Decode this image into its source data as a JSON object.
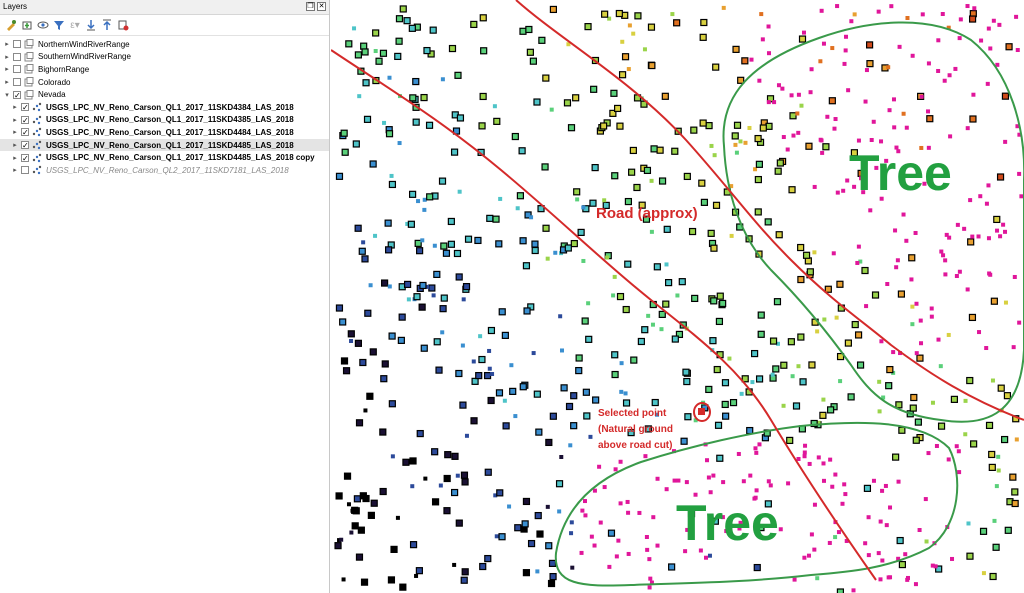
{
  "layers_panel": {
    "title": "Layers",
    "title_buttons": [
      "restore-icon",
      "close-icon"
    ],
    "toolbar_icons": [
      "open-layer-styling-icon",
      "add-group-icon",
      "manage-map-themes-icon",
      "filter-legend-icon",
      "filter-by-expression-icon",
      "expand-all-icon",
      "collapse-all-icon",
      "remove-layer-icon"
    ],
    "items": [
      {
        "label": "NorthernWindRiverRange",
        "checked": false,
        "indent": 0,
        "kind": "group",
        "expanded": false,
        "style": "normal"
      },
      {
        "label": "SouthernWindRiverRange",
        "checked": false,
        "indent": 0,
        "kind": "group",
        "expanded": false,
        "style": "normal"
      },
      {
        "label": "BighornRange",
        "checked": false,
        "indent": 0,
        "kind": "group",
        "expanded": false,
        "style": "normal"
      },
      {
        "label": "Colorado",
        "checked": false,
        "indent": 0,
        "kind": "group",
        "expanded": false,
        "style": "normal"
      },
      {
        "label": "Nevada",
        "checked": true,
        "indent": 0,
        "kind": "group",
        "expanded": true,
        "style": "normal"
      },
      {
        "label": "USGS_LPC_NV_Reno_Carson_QL1_2017_11SKD4384_LAS_2018",
        "checked": true,
        "indent": 1,
        "kind": "pointcloud",
        "style": "bold"
      },
      {
        "label": "USGS_LPC_NV_Reno_Carson_QL1_2017_11SKD4385_LAS_2018",
        "checked": true,
        "indent": 1,
        "kind": "pointcloud",
        "style": "bold"
      },
      {
        "label": "USGS_LPC_NV_Reno_Carson_QL1_2017_11SKD4484_LAS_2018",
        "checked": true,
        "indent": 1,
        "kind": "pointcloud",
        "style": "bold"
      },
      {
        "label": "USGS_LPC_NV_Reno_Carson_QL1_2017_11SKD4485_LAS_2018",
        "checked": true,
        "indent": 1,
        "kind": "pointcloud",
        "style": "bold",
        "selected": true
      },
      {
        "label": "USGS_LPC_NV_Reno_Carson_QL1_2017_11SKD4485_LAS_2018 copy",
        "checked": true,
        "indent": 1,
        "kind": "pointcloud",
        "style": "bold"
      },
      {
        "label": "USGS_LPC_NV_Reno_Carson_QL2_2017_11SKD7181_LAS_2018",
        "checked": false,
        "indent": 1,
        "kind": "pointcloud",
        "style": "italic-gray"
      }
    ]
  },
  "map": {
    "annotations": {
      "road": "Road (approx)",
      "tree_upper": "Tree",
      "tree_lower": "Tree",
      "selected_line1": "Selected point",
      "selected_line2": "(Natural ground",
      "selected_line3": "above road cut)"
    },
    "colors": {
      "road": "#d42a2a",
      "tree_outline": "#3a9a4a",
      "tree_text": "#22a040",
      "annotation_text": "#d42a2a",
      "vegetation_points": "#e0169a"
    },
    "point_palette": [
      "#000000",
      "#1a1033",
      "#2c4a9a",
      "#3a8fd0",
      "#4ec4c8",
      "#5ad07a",
      "#9ad44a",
      "#d8d040",
      "#e8a030",
      "#e07020",
      "#d04a1a"
    ]
  }
}
